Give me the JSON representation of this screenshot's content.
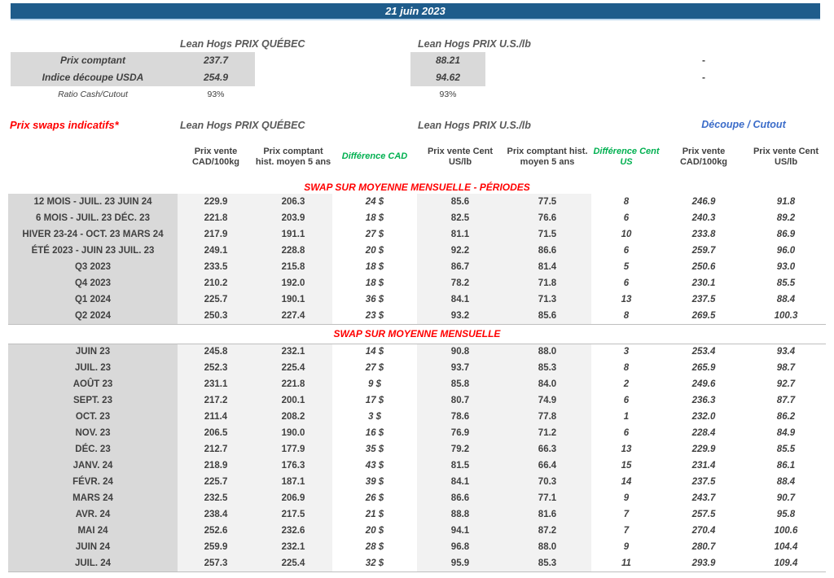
{
  "colors": {
    "bar_blue": "#1F5C8B",
    "bar_underline": "#BDD7EE",
    "label_grey": "#D9D9D9",
    "band_grey": "#F2F2F2",
    "text_dark": "#404040",
    "header_grey": "#595959",
    "red": "#FF0000",
    "green": "#00B050",
    "blue": "#3B6CC9",
    "line_grey": "#BFBFBF"
  },
  "date_bar": {
    "title": "21 juin 2023"
  },
  "summary": {
    "qc_header": "Lean Hogs PRIX QUÉBEC",
    "us_header": "Lean Hogs PRIX U.S./lb",
    "rows": [
      {
        "label": "Prix comptant",
        "qc": "237.7",
        "us": "88.21",
        "cutout": "-"
      },
      {
        "label": "Indice découpe USDA",
        "qc": "254.9",
        "us": "94.62",
        "cutout": "-"
      },
      {
        "label": "Ratio Cash/Cutout",
        "qc": "93%",
        "us": "93%",
        "cutout": ""
      }
    ]
  },
  "swaps": {
    "label": "Prix swaps indicatifs*",
    "group_headers": {
      "qc": "Lean Hogs PRIX QUÉBEC",
      "us": "Lean Hogs PRIX U.S./lb",
      "cutout": "Découpe / Cutout"
    },
    "columns": [
      "Prix vente CAD/100kg",
      "Prix comptant hist. moyen 5 ans",
      "Différence CAD",
      "Prix vente Cent US/lb",
      "Prix comptant hist. moyen 5 ans",
      "Différence Cent US",
      "Prix vente CAD/100kg",
      "Prix vente Cent US/lb"
    ],
    "sections": [
      {
        "title": "SWAP SUR MOYENNE MENSUELLE - PÉRIODES",
        "rows": [
          [
            "12 MOIS - JUIL. 23 JUIN 24",
            "229.9",
            "206.3",
            "24 $",
            "85.6",
            "77.5",
            "8",
            "246.9",
            "91.8"
          ],
          [
            "6 MOIS - JUIL. 23 DÉC. 23",
            "221.8",
            "203.9",
            "18 $",
            "82.5",
            "76.6",
            "6",
            "240.3",
            "89.2"
          ],
          [
            "HIVER 23-24 -  OCT. 23 MARS 24",
            "217.9",
            "191.1",
            "27 $",
            "81.1",
            "71.5",
            "10",
            "233.8",
            "86.9"
          ],
          [
            "ÉTÉ 2023 - JUIN 23 JUIL. 23",
            "249.1",
            "228.8",
            "20 $",
            "92.2",
            "86.6",
            "6",
            "259.7",
            "96.0"
          ],
          [
            "Q3 2023",
            "233.5",
            "215.8",
            "18 $",
            "86.7",
            "81.4",
            "5",
            "250.6",
            "93.0"
          ],
          [
            "Q4 2023",
            "210.2",
            "192.0",
            "18 $",
            "78.2",
            "71.8",
            "6",
            "230.1",
            "85.5"
          ],
          [
            "Q1 2024",
            "225.7",
            "190.1",
            "36 $",
            "84.1",
            "71.3",
            "13",
            "237.5",
            "88.4"
          ],
          [
            "Q2 2024",
            "250.3",
            "227.4",
            "23 $",
            "93.2",
            "85.6",
            "8",
            "269.5",
            "100.3"
          ]
        ]
      },
      {
        "title": "SWAP SUR MOYENNE MENSUELLE",
        "rows": [
          [
            "JUIN 23",
            "245.8",
            "232.1",
            "14 $",
            "90.8",
            "88.0",
            "3",
            "253.4",
            "93.4"
          ],
          [
            "JUIL. 23",
            "252.3",
            "225.4",
            "27 $",
            "93.7",
            "85.3",
            "8",
            "265.9",
            "98.7"
          ],
          [
            "AOÛT 23",
            "231.1",
            "221.8",
            "9 $",
            "85.8",
            "84.0",
            "2",
            "249.6",
            "92.7"
          ],
          [
            "SEPT. 23",
            "217.2",
            "200.1",
            "17 $",
            "80.7",
            "74.9",
            "6",
            "236.3",
            "87.7"
          ],
          [
            "OCT. 23",
            "211.4",
            "208.2",
            "3 $",
            "78.6",
            "77.8",
            "1",
            "232.0",
            "86.2"
          ],
          [
            "NOV. 23",
            "206.5",
            "190.0",
            "16 $",
            "76.9",
            "71.2",
            "6",
            "228.4",
            "84.9"
          ],
          [
            "DÉC. 23",
            "212.7",
            "177.9",
            "35 $",
            "79.2",
            "66.3",
            "13",
            "229.9",
            "85.5"
          ],
          [
            "JANV. 24",
            "218.9",
            "176.3",
            "43 $",
            "81.5",
            "66.4",
            "15",
            "231.4",
            "86.1"
          ],
          [
            "FÉVR. 24",
            "225.7",
            "187.1",
            "39 $",
            "84.1",
            "70.3",
            "14",
            "237.5",
            "88.4"
          ],
          [
            "MARS 24",
            "232.5",
            "206.9",
            "26 $",
            "86.6",
            "77.1",
            "9",
            "243.7",
            "90.7"
          ],
          [
            "AVR. 24",
            "238.4",
            "217.5",
            "21 $",
            "88.8",
            "81.6",
            "7",
            "257.5",
            "95.8"
          ],
          [
            "MAI 24",
            "252.6",
            "232.6",
            "20 $",
            "94.1",
            "87.2",
            "7",
            "270.4",
            "100.6"
          ],
          [
            "JUIN 24",
            "259.9",
            "232.1",
            "28 $",
            "96.8",
            "88.0",
            "9",
            "280.7",
            "104.4"
          ],
          [
            "JUIL. 24",
            "257.3",
            "225.4",
            "32 $",
            "95.9",
            "85.3",
            "11",
            "293.9",
            "109.4"
          ]
        ]
      }
    ]
  }
}
